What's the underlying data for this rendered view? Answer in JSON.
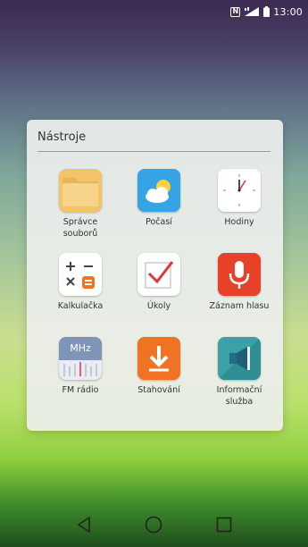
{
  "status_bar": {
    "nfc_icon": "nfc-icon",
    "nfc_text": "N",
    "time": "13:00"
  },
  "folder": {
    "title": "Nástroje",
    "apps": [
      {
        "label": "Správce\nsouborů",
        "icon": "folder-icon"
      },
      {
        "label": "Počasí",
        "icon": "weather-icon"
      },
      {
        "label": "Hodiny",
        "icon": "clock-icon"
      },
      {
        "label": "Kalkulačka",
        "icon": "calculator-icon"
      },
      {
        "label": "Úkoly",
        "icon": "tasks-icon"
      },
      {
        "label": "Záznam hlasu",
        "icon": "microphone-icon"
      },
      {
        "label": "FM rádio",
        "icon": "radio-icon",
        "icon_text": "MHz"
      },
      {
        "label": "Stahování",
        "icon": "download-icon"
      },
      {
        "label": "Informační\nslužba",
        "icon": "broadcast-icon"
      }
    ]
  },
  "navbar": {
    "back": "back-icon",
    "home": "home-icon",
    "recents": "recents-icon"
  },
  "colors": {
    "file_manager": "#f3cc72",
    "weather": "#2f9ee0",
    "clock": "#ffffff",
    "calculator": "#ffffff",
    "calculator_accent": "#f07224",
    "tasks": "#ffffff",
    "tasks_accent": "#e6353a",
    "voice_recorder": "#e8412a",
    "radio": "#7d93b6",
    "download": "#f07224",
    "broadcast": "#3fa3a3"
  }
}
